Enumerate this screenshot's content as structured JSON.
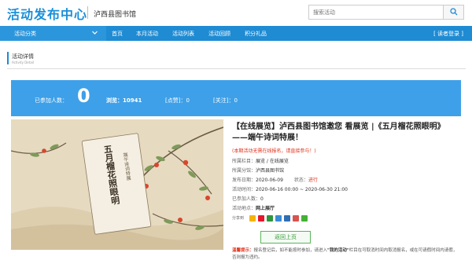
{
  "header": {
    "logo": "活动发布中心",
    "library_name": "泸西县图书馆",
    "search": {
      "placeholder": "搜索活动"
    }
  },
  "nav": {
    "category": "活动分类",
    "items": [
      "首页",
      "本月活动",
      "活动列表",
      "活动回顾",
      "积分礼品"
    ],
    "login": "[ 读者登录 ]"
  },
  "section": {
    "title": "活动详情",
    "subtitle": "Activity Detail"
  },
  "stats": {
    "joined_label": "已参加人数：",
    "joined_value": "0",
    "views": "浏览：10941",
    "likes": "[点赞]：0",
    "follows": "[关注]：0"
  },
  "poster": {
    "title_text": "五月榴花照眼明",
    "subtitle_text": "端午诗词特展"
  },
  "detail": {
    "title": "【在线展览】泸西县图书馆邀您 看展览 |《五月榴花照眼明》——端午诗词特展！",
    "notice": "(本期活动无需在线报名，请直接参与！)",
    "rows": [
      {
        "k": "所属栏目：",
        "v": "展览 / 在线展览"
      },
      {
        "k": "所属分馆：",
        "v": "泸西县图书馆"
      },
      {
        "k": "发布日期：",
        "v": "2020-06-09",
        "k2": "状态：",
        "v2": "进行"
      },
      {
        "k": "活动时间：",
        "v": "2020-06-16 00:00 ~ 2020-06-30 21:00"
      },
      {
        "k": "已参加人数：",
        "v": "0"
      },
      {
        "k": "活动地点：",
        "v": "网上展厅"
      }
    ],
    "share_label": "分享到",
    "share_icons": [
      "qzone-icon",
      "weibo-icon",
      "douban-icon",
      "tencent-weibo-icon",
      "renren-icon",
      "kaixin-icon",
      "wechat-icon"
    ],
    "back_button": "返回上页",
    "tip_label": "温馨提示：",
    "tip_text_1": "报名登记后，如不能按时参加，请进入",
    "tip_bold": "\"我的活动\"",
    "tip_text_2": "栏目在可取消时间内取消报名，或在可请假时间内请假，否则报为违约。"
  },
  "colors": {
    "brand": "#1a8fd8",
    "nav_bg": "#1e8bd3",
    "stats_bg": "#3ea0e8",
    "accent_red": "#e0321b",
    "button_green": "#5bb55b"
  }
}
